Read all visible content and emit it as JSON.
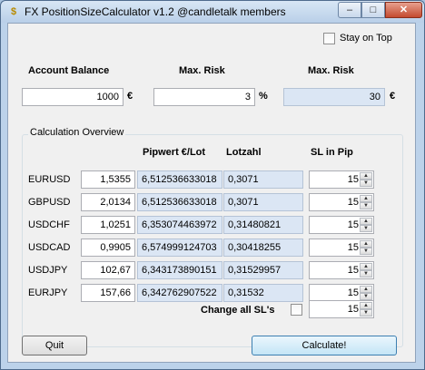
{
  "window": {
    "title": "FX PositionSizeCalculator v1.2 @candletalk members"
  },
  "titlebar_buttons": {
    "minimize": "–",
    "maximize": "□",
    "close": "✕"
  },
  "stay_on_top": {
    "label": "Stay on Top",
    "checked": false
  },
  "top_labels": {
    "account_balance": "Account Balance",
    "max_risk": "Max. Risk",
    "max_risk_2": "Max. Risk"
  },
  "account_balance": {
    "value": "1000",
    "unit": "€"
  },
  "max_risk_percent": {
    "value": "3",
    "unit": "%"
  },
  "max_risk_amount": {
    "value": "30",
    "unit": "€"
  },
  "group": {
    "title": "Calculation Overview"
  },
  "columns": {
    "pipwert": "Pipwert €/Lot",
    "lotzahl": "Lotzahl",
    "sl": "SL in Pip"
  },
  "rows": [
    {
      "pair": "EURUSD",
      "price": "1,5355",
      "pipwert": "6,512536633018",
      "lotzahl": "0,3071",
      "sl": "15"
    },
    {
      "pair": "GBPUSD",
      "price": "2,0134",
      "pipwert": "6,512536633018",
      "lotzahl": "0,3071",
      "sl": "15"
    },
    {
      "pair": "USDCHF",
      "price": "1,0251",
      "pipwert": "6,353074463972",
      "lotzahl": "0,31480821",
      "sl": "15"
    },
    {
      "pair": "USDCAD",
      "price": "0,9905",
      "pipwert": "6,574999124703",
      "lotzahl": "0,30418255",
      "sl": "15"
    },
    {
      "pair": "USDJPY",
      "price": "102,67",
      "pipwert": "6,343173890151",
      "lotzahl": "0,31529957",
      "sl": "15"
    },
    {
      "pair": "EURJPY",
      "price": "157,66",
      "pipwert": "6,342762907522",
      "lotzahl": "0,31532",
      "sl": "15"
    }
  ],
  "change_all": {
    "label": "Change all SL's",
    "checked": false,
    "value": "15"
  },
  "buttons": {
    "quit": "Quit",
    "calculate": "Calculate!"
  }
}
